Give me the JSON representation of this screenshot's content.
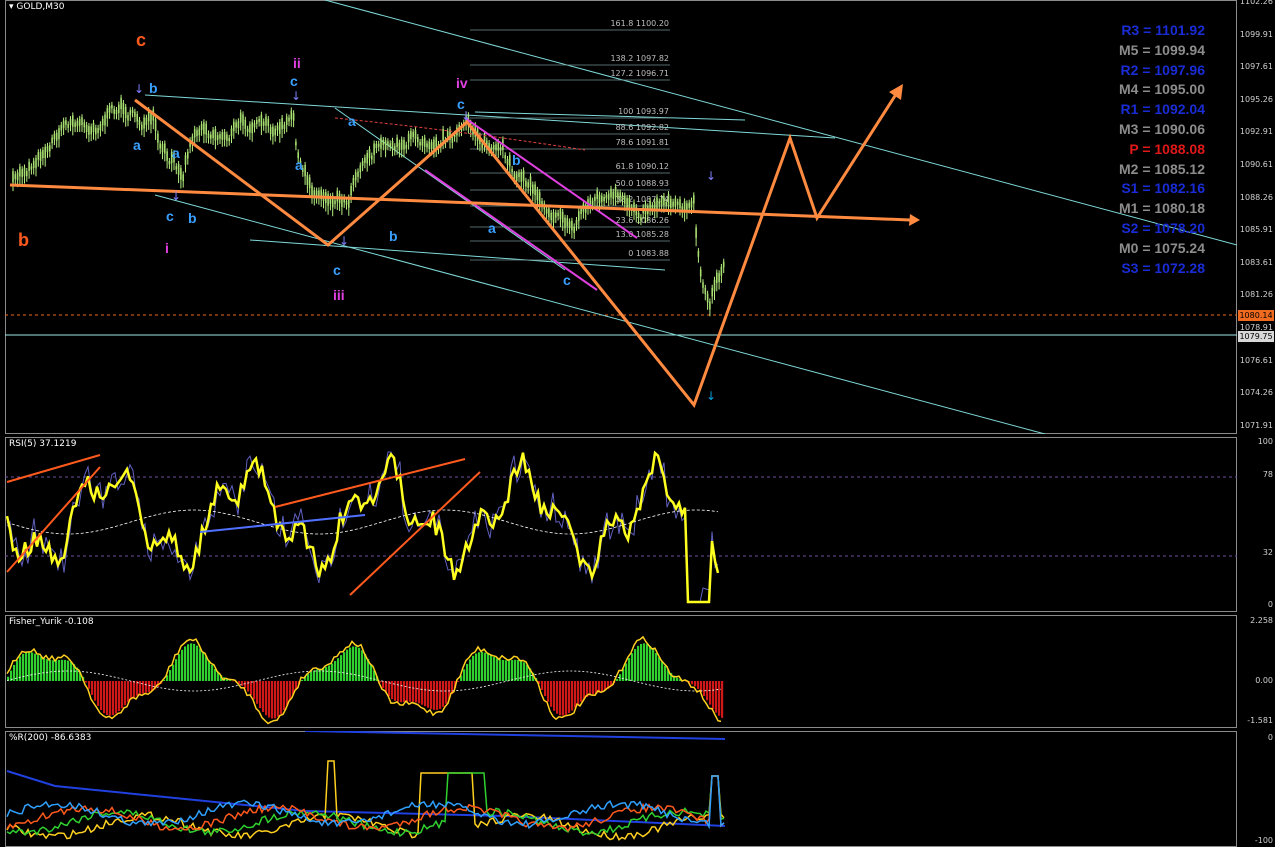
{
  "symbol_title": "GOLD,M30",
  "main_axis": [
    "1102.26",
    "1099.91",
    "1097.61",
    "1095.26",
    "1092.91",
    "1090.61",
    "1088.26",
    "1085.91",
    "1083.61",
    "1081.26",
    "1078.91",
    "1076.61",
    "1074.26",
    "1071.91"
  ],
  "price_tags": [
    {
      "value": "1080.14",
      "bg": "#f06a20"
    },
    {
      "value": "1079.75",
      "bg": "#d8d8d8"
    }
  ],
  "fib_levels": [
    "161.8 1100.20",
    "138.2 1097.82",
    "127.2 1096.71",
    "100 1093.97",
    "88.6 1092.82",
    "78.6 1091.81",
    "61.8 1090.12",
    "50.0 1088.93",
    "38.2 1087.74",
    "23.6 1086.26",
    "13.0 1085.28",
    "0 1083.88"
  ],
  "pivots": [
    {
      "label": "R3 = 1101.92",
      "color": "#1a2cd6"
    },
    {
      "label": "M5 = 1099.94",
      "color": "#8c8c8c"
    },
    {
      "label": "R2 = 1097.96",
      "color": "#1a2cd6"
    },
    {
      "label": "M4 = 1095.00",
      "color": "#8c8c8c"
    },
    {
      "label": "R1 = 1092.04",
      "color": "#1a2cd6"
    },
    {
      "label": "M3 = 1090.06",
      "color": "#8c8c8c"
    },
    {
      "label": "P  = 1088.08",
      "color": "#e01818"
    },
    {
      "label": "M2 = 1085.12",
      "color": "#8c8c8c"
    },
    {
      "label": "S1 = 1082.16",
      "color": "#1a2cd6"
    },
    {
      "label": "M1 = 1080.18",
      "color": "#8c8c8c"
    },
    {
      "label": "S2 = 1078.20",
      "color": "#1a2cd6"
    },
    {
      "label": "M0 = 1075.24",
      "color": "#8c8c8c"
    },
    {
      "label": "S3 = 1072.28",
      "color": "#1a2cd6"
    }
  ],
  "waves": [
    {
      "t": "c",
      "color": "#ff5a1e"
    },
    {
      "t": "b",
      "color": "#ff5a1e"
    },
    {
      "t": "ii",
      "color": "#e040e0"
    },
    {
      "t": "iv",
      "color": "#e040e0"
    },
    {
      "t": "i",
      "color": "#e040e0"
    },
    {
      "t": "iii",
      "color": "#e040e0"
    },
    {
      "t": "b",
      "color": "#3aa0ff"
    },
    {
      "t": "a",
      "color": "#3aa0ff"
    },
    {
      "t": "a",
      "color": "#3aa0ff"
    },
    {
      "t": "c",
      "color": "#3aa0ff"
    },
    {
      "t": "b",
      "color": "#3aa0ff"
    },
    {
      "t": "c",
      "color": "#3aa0ff"
    },
    {
      "t": "a",
      "color": "#3aa0ff"
    },
    {
      "t": "c",
      "color": "#3aa0ff"
    },
    {
      "t": "b",
      "color": "#3aa0ff"
    },
    {
      "t": "a",
      "color": "#3aa0ff"
    },
    {
      "t": "c",
      "color": "#3aa0ff"
    },
    {
      "t": "b",
      "color": "#3aa0ff"
    },
    {
      "t": "a",
      "color": "#3aa0ff"
    },
    {
      "t": "c",
      "color": "#3aa0ff"
    }
  ],
  "rsi": {
    "title": "RSI(5) 37.1219",
    "axis": [
      "100",
      "78",
      "32",
      "0"
    ]
  },
  "fisher": {
    "title": "Fisher_Yurik -0.108",
    "axis": [
      "2.258",
      "0.00",
      "-1.581"
    ]
  },
  "wpr": {
    "title": "%R(200) -86.6383",
    "axis": [
      "0",
      "-100"
    ]
  }
}
